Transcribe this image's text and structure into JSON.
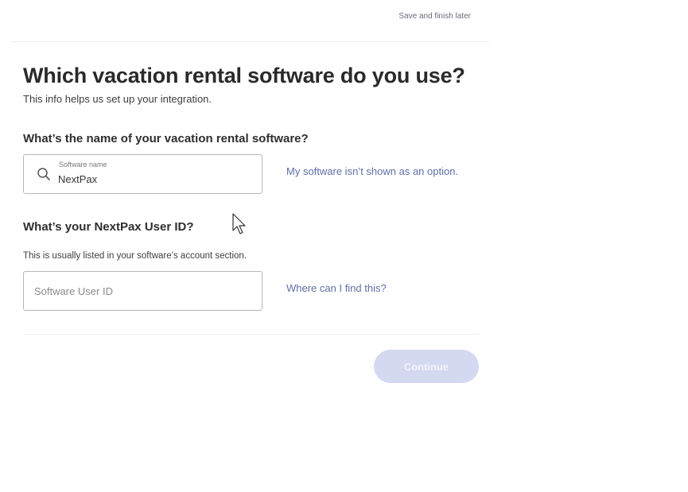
{
  "header": {
    "save_label": "Save and finish later"
  },
  "page": {
    "title": "Which vacation rental software do you use?",
    "subtitle": "This info helps us set up your integration."
  },
  "software_section": {
    "question": "What’s the name of your vacation rental software?",
    "field_label": "Software name",
    "field_value": "NextPax",
    "side_link": "My software isn’t shown as an option."
  },
  "user_id_section": {
    "question": "What’s your NextPax User ID?",
    "hint": "This is usually listed in your software’s account section.",
    "placeholder": "Software User ID",
    "side_link": "Where can I find this?"
  },
  "footer": {
    "continue_label": "Continue"
  },
  "colors": {
    "link": "#5e6fa6",
    "button_disabled_bg": "#d4d8f0",
    "text": "#2c2c2c"
  },
  "icons": {
    "search": "search-icon",
    "cursor": "mouse-pointer-icon"
  }
}
